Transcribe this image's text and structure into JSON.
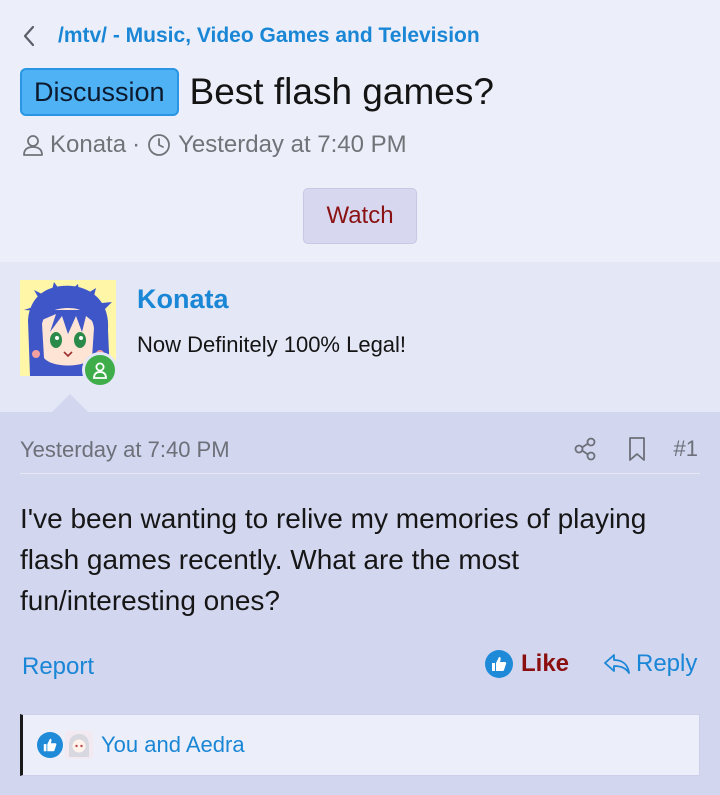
{
  "breadcrumb": {
    "back_icon": "chevron-left-icon",
    "label": "/mtv/ - Music, Video Games and Television"
  },
  "thread": {
    "prefix": "Discussion",
    "title": "Best flash games?",
    "author": "Konata",
    "separator": "·",
    "date": "Yesterday at 7:40 PM",
    "watch_label": "Watch"
  },
  "user": {
    "name": "Konata",
    "title": "Now Definitely 100% Legal!",
    "status": "online",
    "avatar_icon": "avatar-icon"
  },
  "post": {
    "date": "Yesterday at 7:40 PM",
    "number": "#1",
    "body": "I've been wanting to relive my memories of playing flash games recently. What are the most fun/interesting ones?",
    "report_label": "Report",
    "like_label": "Like",
    "reply_label": "Reply"
  },
  "reactions": {
    "text": "You and Aedra"
  },
  "colors": {
    "accent": "#1a86d6",
    "badge": "#4fb2f5",
    "like": "#8c0f0f",
    "online": "#3fae4a"
  }
}
